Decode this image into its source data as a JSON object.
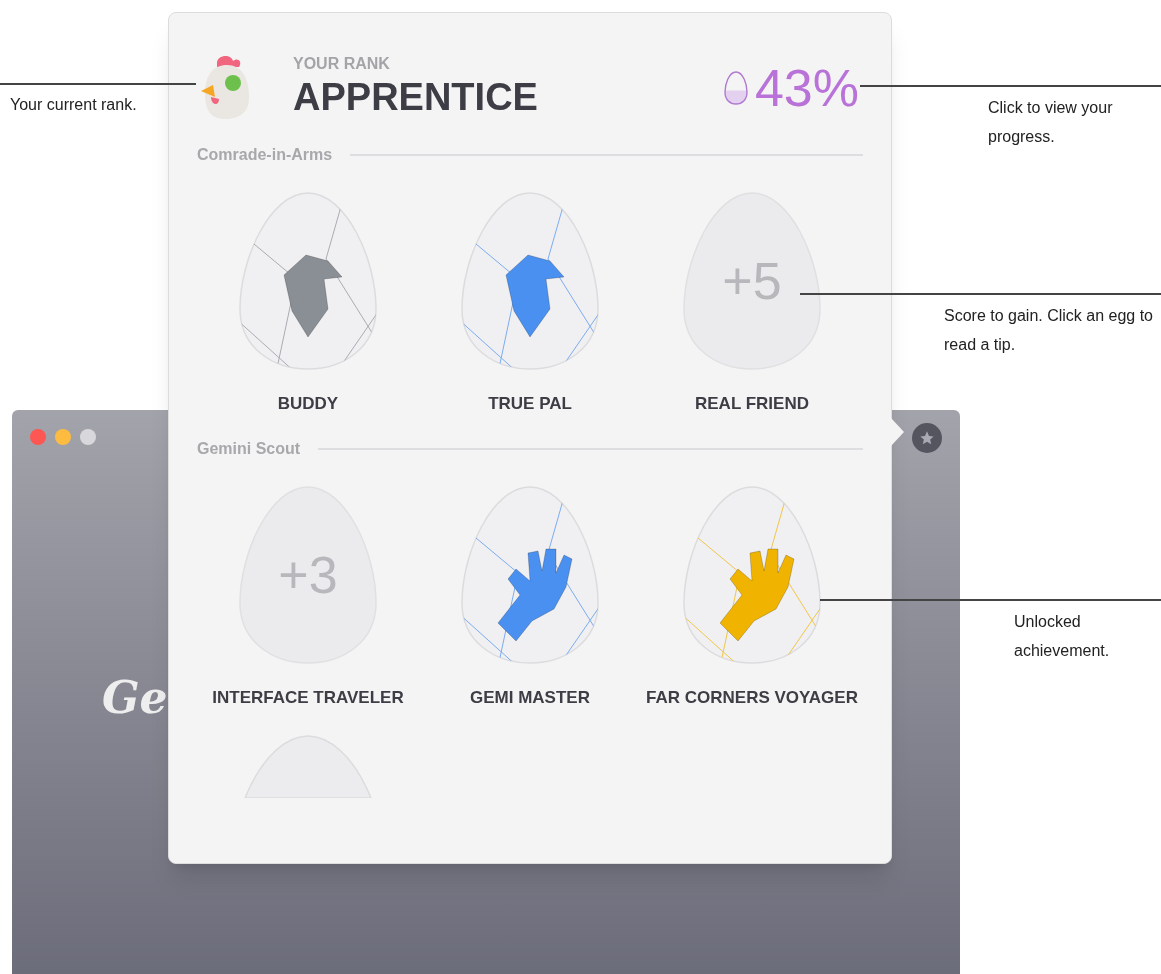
{
  "app_window": {
    "traffic_lights": [
      {
        "color": "#fc5753"
      },
      {
        "color": "#fdbc40"
      },
      {
        "color": "#d8d8dc"
      }
    ],
    "logo": "Ge"
  },
  "popover": {
    "rank_label": "YOUR RANK",
    "rank": "APPRENTICE",
    "progress": {
      "text": "43%",
      "level": 0.43
    },
    "sections": [
      {
        "title": "Comrade-in-Arms",
        "achievements": [
          {
            "kind": "bird",
            "color": "#8a8f96",
            "name": "BUDDY"
          },
          {
            "kind": "bird",
            "color": "#4a90f0",
            "name": "TRUE PAL"
          },
          {
            "kind": "locked",
            "score": "+5",
            "name": "REAL FRIEND"
          }
        ]
      },
      {
        "title": "Gemini Scout",
        "achievements": [
          {
            "kind": "locked",
            "score": "+3",
            "name": "INTERFACE TRAVELER"
          },
          {
            "kind": "hand",
            "color": "#4a90f0",
            "name": "GEMI MASTER"
          },
          {
            "kind": "hand",
            "color": "#f0b400",
            "name": "FAR CORNERS VOYAGER"
          }
        ]
      },
      {
        "achievements": [
          {
            "kind": "cut"
          }
        ]
      }
    ]
  },
  "callouts": [
    {
      "text": "Your current rank."
    },
    {
      "text": "Click to view your progress."
    },
    {
      "text": "Score to gain. Click an egg to read a tip."
    },
    {
      "text": "Unlocked achievement."
    }
  ]
}
